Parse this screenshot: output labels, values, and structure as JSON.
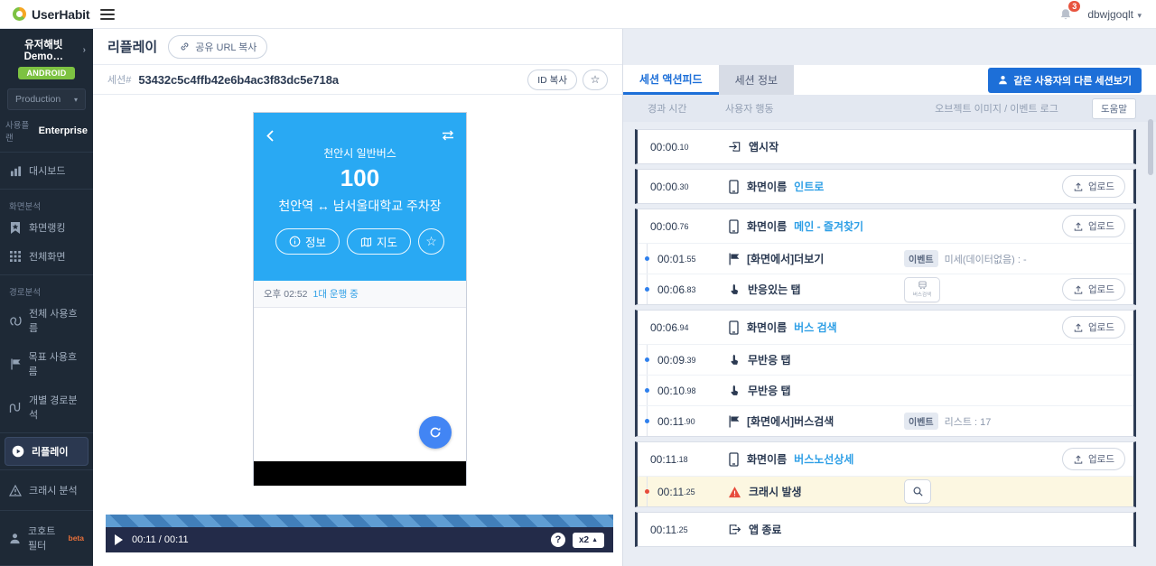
{
  "colors": {
    "accent_blue": "#1d6fd8",
    "screen_link_blue": "#2e9fe6",
    "phone_header_blue": "#29a9f3",
    "sidebar_navy": "#1e2936",
    "android_badge_green": "#7dc242",
    "crash_red": "#e74c3c",
    "crash_row_bg": "#fcf7e1",
    "notification_red": "#e8543f",
    "fab_blue": "#4285f4"
  },
  "topbar": {
    "brand": "UserHabit",
    "notification_count": "3",
    "username": "dbwjgoqlt"
  },
  "sidebar": {
    "app_name": "유저해빗 Demo…",
    "platform_badge": "ANDROID",
    "environment": "Production",
    "plan_label": "사용플랜",
    "plan_value": "Enterprise",
    "item_dashboard": "대시보드",
    "section_screen": "화면분석",
    "item_screen_ranking": "화면랭킹",
    "item_all_screens": "전체화면",
    "section_path": "경로분석",
    "item_all_flow": "전체 사용흐름",
    "item_goal_flow": "목표 사용흐름",
    "item_individual_path": "개별 경로분석",
    "item_replay": "리플레이",
    "item_crash": "크래시 분석",
    "item_cohort": "코호트 필터",
    "cohort_beta": "beta"
  },
  "main": {
    "page_title": "리플레이",
    "share_url_button": "공유 URL 복사",
    "session_label": "세션#",
    "session_id": "53432c5c4ffb42e6b4ac3f83dc5e718a",
    "id_copy_button": "ID 복사"
  },
  "phone": {
    "category": "천안시 일반버스",
    "route_number": "100",
    "route_desc": "천안역 ↔ 남서울대학교 주차장",
    "info_button": "정보",
    "map_button": "지도",
    "status_time": "오후 02:52",
    "status_text": "1대 운행 중"
  },
  "player": {
    "time": "00:11 / 00:11",
    "speed": "x2"
  },
  "feed": {
    "tab_action_feed": "세션 액션피드",
    "tab_session_info": "세션 정보",
    "other_sessions_button": "같은 사용자의 다른 세션보기",
    "col_time": "경과 시간",
    "col_action": "사용자 행동",
    "col_object": "오브젝트 이미지 / 이벤트 로그",
    "help_button": "도움말",
    "upload_label": "업로드",
    "rows": [
      {
        "time": "00:00",
        "ms": ".10",
        "action": "앱시작"
      },
      {
        "time": "00:00",
        "ms": ".30",
        "prefix": "화면이름",
        "screen": "인트로"
      },
      {
        "time": "00:00",
        "ms": ".76",
        "prefix": "화면이름",
        "screen": "메인 - 즐겨찾기"
      },
      {
        "time": "00:01",
        "ms": ".55",
        "action": "[화면에서]더보기",
        "badge": "이벤트",
        "event": "미세(데이터없음) : -"
      },
      {
        "time": "00:06",
        "ms": ".83",
        "action": "반응있는 탭",
        "thumb_label": "버스검색"
      },
      {
        "time": "00:06",
        "ms": ".94",
        "prefix": "화면이름",
        "screen": "버스 검색"
      },
      {
        "time": "00:09",
        "ms": ".39",
        "action": "무반응 탭"
      },
      {
        "time": "00:10",
        "ms": ".98",
        "action": "무반응 탭"
      },
      {
        "time": "00:11",
        "ms": ".90",
        "action": "[화면에서]버스검색",
        "badge": "이벤트",
        "event": "리스트 : 17"
      },
      {
        "time": "00:11",
        "ms": ".18",
        "prefix": "화면이름",
        "screen": "버스노선상세"
      },
      {
        "time": "00:11",
        "ms": ".25",
        "action": "크래시 발생"
      },
      {
        "time": "00:11",
        "ms": ".25",
        "action": "앱 종료"
      }
    ]
  }
}
